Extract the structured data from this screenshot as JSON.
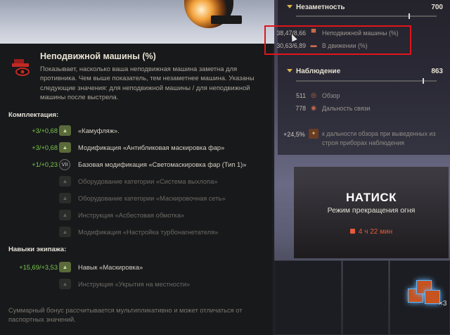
{
  "tooltip": {
    "title": "Неподвижной машины (%)",
    "description": "Показывает, насколько ваша неподвижная машина заметна для противника. Чем выше показатель, тем незаметнее машина. Указаны следующие значения: для неподвижной машины / для неподвижной машины после выстрела.",
    "equipment_title": "Комплектация:",
    "equipment": [
      {
        "value": "+3/+0,68",
        "icon": "camouflage-icon",
        "label": "«Камуфляж».",
        "active": true
      },
      {
        "value": "+3/+0,68",
        "icon": "headlight-mod-icon",
        "label": "Модификация «Антибликовая маскировка фар»",
        "active": true
      },
      {
        "value": "+1/+0,23",
        "icon": "vii-badge-icon",
        "label": "Базовая модификация «Светомаскировка фар (Тип 1)»",
        "active": true
      },
      {
        "value": "",
        "icon": "exhaust-equipment-icon",
        "label": "Оборудование категории «Система выхлопа»",
        "active": false
      },
      {
        "value": "",
        "icon": "camo-net-equipment-icon",
        "label": "Оборудование категории «Маскировочная сеть»",
        "active": false
      },
      {
        "value": "",
        "icon": "asbestos-wrap-icon",
        "label": "Инструкция «Асбестовая обмотка»",
        "active": false
      },
      {
        "value": "",
        "icon": "turbo-tuning-icon",
        "label": "Модификация «Настройка турбонагнетателя»",
        "active": false
      }
    ],
    "crew_title": "Навыки экипажа:",
    "crew": [
      {
        "value": "+15,69/+3,53",
        "icon": "concealment-skill-icon",
        "label": "Навык «Маскировка»",
        "active": true
      },
      {
        "value": "",
        "icon": "terrain-cover-icon",
        "label": "Инструкция «Укрытия на местности»",
        "active": false
      }
    ],
    "footnote": "Суммарный бонус рассчитывается мультипликативно и может отличаться от паспортных значений."
  },
  "stats": {
    "concealment": {
      "title": "Незаметность",
      "value": "700",
      "slider_level": 0.8,
      "rows": [
        {
          "num": "38,47/8,66",
          "icon": "stationary-tank-icon",
          "label": "Неподвижной машины (%)"
        },
        {
          "num": "30,63/6,89",
          "icon": "moving-tank-icon",
          "label": "В движении (%)"
        }
      ]
    },
    "observation": {
      "title": "Наблюдение",
      "value": "863",
      "slider_level": 0.9,
      "rows": [
        {
          "num": "511",
          "icon": "view-range-icon",
          "label": "Обзор"
        },
        {
          "num": "778",
          "icon": "radio-range-icon",
          "label": "Дальность связи"
        }
      ],
      "bonus": {
        "value": "+24,5%",
        "icon": "optics-icon",
        "text": "к дальности обзора при выведенных из строя приборах наблюдения"
      }
    }
  },
  "banner": {
    "title": "НАТИСК",
    "subtitle": "Режим прекращения огня",
    "timer": "4 ч 22 мин"
  },
  "gift_count": "×3",
  "colors": {
    "accent_green": "#79c74c",
    "highlight_red": "#e1141b",
    "timer_red": "#e85a3a"
  }
}
